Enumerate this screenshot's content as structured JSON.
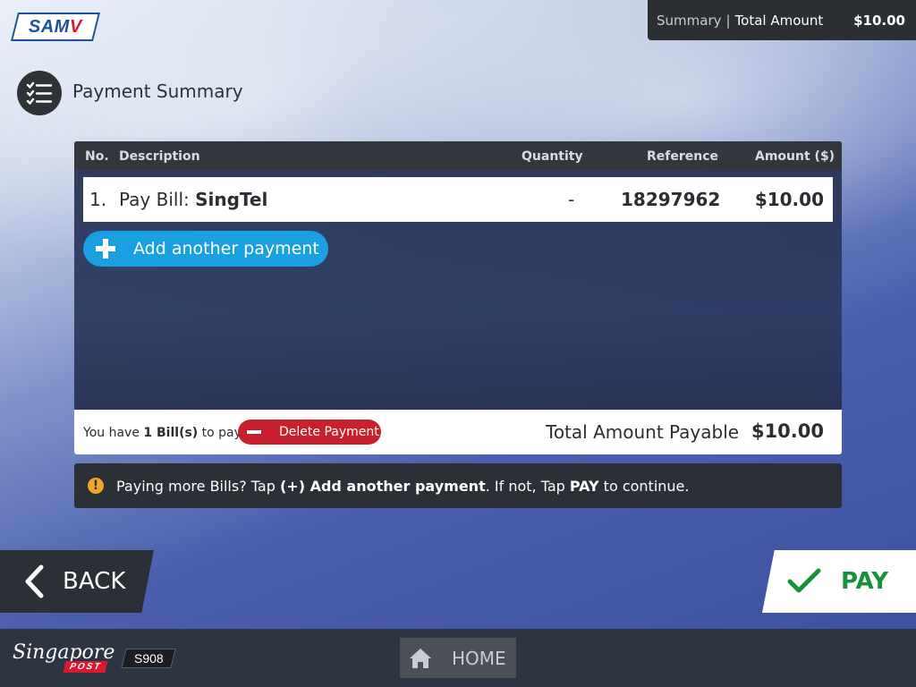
{
  "logo": {
    "text": "SAM",
    "accent": "V"
  },
  "summary_bar": {
    "label": "Summary",
    "separator": "|",
    "title": "Total Amount",
    "amount": "$10.00"
  },
  "page": {
    "title": "Payment Summary"
  },
  "table": {
    "headers": {
      "no": "No.",
      "description": "Description",
      "quantity": "Quantity",
      "reference": "Reference",
      "amount": "Amount ($)"
    },
    "rows": [
      {
        "no": "1.",
        "description_prefix": "Pay Bill: ",
        "description_name": "SingTel",
        "quantity": "-",
        "reference": "18297962",
        "amount": "$10.00"
      }
    ],
    "add_button": "Add another payment"
  },
  "footer": {
    "bill_text_prefix": "You have ",
    "bill_count": "1 Bill(s)",
    "bill_text_suffix": " to pay.",
    "delete_button": "Delete Payment",
    "total_label": "Total Amount Payable",
    "total_amount": "$10.00"
  },
  "info": {
    "part1": "Paying more Bills? Tap ",
    "bold1": "(+) Add another payment",
    "part2": ". If not, Tap ",
    "bold2": "PAY",
    "part3": " to continue."
  },
  "nav": {
    "back": "BACK",
    "pay": "PAY",
    "home": "HOME"
  },
  "bottom": {
    "brand": "Singapore",
    "brand_sub": "POST",
    "kiosk_id": "S908"
  },
  "colors": {
    "accent_blue": "#1a9fe0",
    "delete_red": "#c8202e",
    "pay_green": "#17923a",
    "dark": "#2b2f36"
  }
}
